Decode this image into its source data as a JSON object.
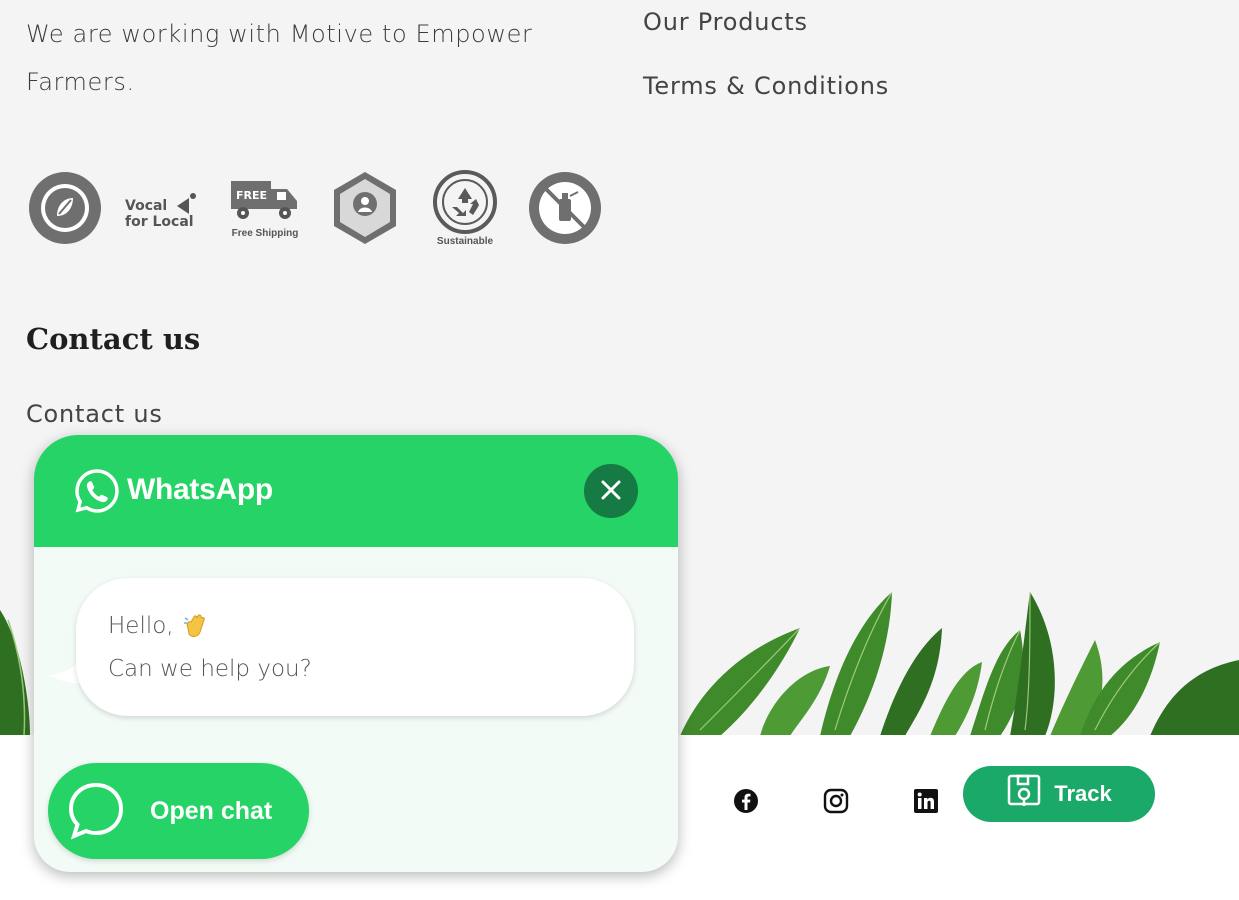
{
  "about": {
    "tagline": "We are working with Motive to Empower Farmers."
  },
  "footer_links": [
    {
      "label": "Our Products"
    },
    {
      "label": "Terms & Conditions"
    }
  ],
  "badges": [
    {
      "icon": "biodegradable-packaging-icon",
      "caption": ""
    },
    {
      "icon": "vocal-for-local-icon",
      "caption": "Vocal for Local"
    },
    {
      "icon": "free-shipping-icon",
      "caption": "Free Shipping"
    },
    {
      "icon": "carbide-free-icon",
      "caption": ""
    },
    {
      "icon": "sustainable-icon",
      "caption": "Sustainable"
    },
    {
      "icon": "pesticide-free-icon",
      "caption": ""
    }
  ],
  "contact": {
    "heading": "Contact us",
    "link": "Contact us"
  },
  "social": [
    {
      "icon": "facebook-icon"
    },
    {
      "icon": "instagram-icon"
    },
    {
      "icon": "linkedin-icon"
    }
  ],
  "track": {
    "label": "Track",
    "icon": "track-package-icon",
    "color": "#1aa968"
  },
  "whatsapp": {
    "title": "WhatsApp",
    "greeting": "Hello,",
    "message": "Can we help you?",
    "open_chat_label": "Open chat",
    "accent": "#25d366",
    "close_color": "#157a43"
  }
}
